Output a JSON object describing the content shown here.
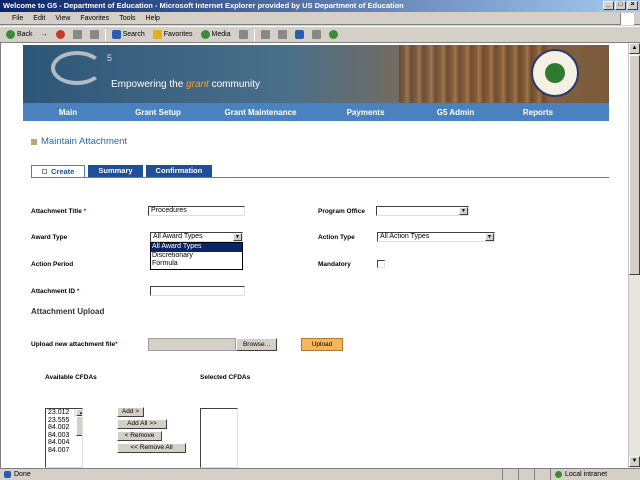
{
  "window": {
    "title": "Welcome to G5 - Department of Education - Microsoft Internet Explorer provided by US Department of Education",
    "minimize": "_",
    "maximize": "□",
    "close": "×"
  },
  "menu": [
    "File",
    "Edit",
    "View",
    "Favorites",
    "Tools",
    "Help"
  ],
  "toolbar": {
    "back": "Back",
    "forward_arrow": "→",
    "search": "Search",
    "favorites": "Favorites",
    "media": "Media"
  },
  "banner": {
    "logo_sup": "5",
    "tagline_pre": "Empowering the ",
    "tagline_grant": "grant",
    "tagline_post": " community"
  },
  "nav": [
    "Main",
    "Grant Setup",
    "Grant Maintenance",
    "Payments",
    "G5 Admin",
    "Reports"
  ],
  "page_title": "Maintain Attachment",
  "tabs": [
    {
      "label": "Create",
      "active": true
    },
    {
      "label": "Summary",
      "active": false
    },
    {
      "label": "Confirmation",
      "active": false
    }
  ],
  "form": {
    "attachment_title_label": "Attachment Title",
    "attachment_title_value": "Procedures",
    "required_mark": "*",
    "program_office_label": "Program Office",
    "program_office_value": "",
    "award_type_label": "Award Type",
    "award_type_value": "All Award Types",
    "award_type_options": [
      "All Award Types",
      "Discretionary",
      "Formula"
    ],
    "action_type_label": "Action Type",
    "action_type_value": "All Action Types",
    "action_period_label": "Action Period",
    "mandatory_label": "Mandatory",
    "attachment_id_label": "Attachment ID",
    "attachment_id_value": "",
    "upload_section": "Attachment Upload",
    "upload_label": "Upload new attachment file",
    "browse_button": "Browse...",
    "upload_button": "Upload",
    "available_cfda_label": "Available CFDAs",
    "selected_cfda_label": "Selected CFDAs",
    "available_cfdas": [
      "23.012",
      "23.555",
      "84.002",
      "84.003",
      "84.004",
      "84.007"
    ],
    "add_button": "Add >",
    "add_all_button": "Add All >>",
    "remove_button": "< Remove",
    "remove_all_button": "<< Remove All"
  },
  "status": {
    "left": "Done",
    "zone": "Local intranet"
  }
}
